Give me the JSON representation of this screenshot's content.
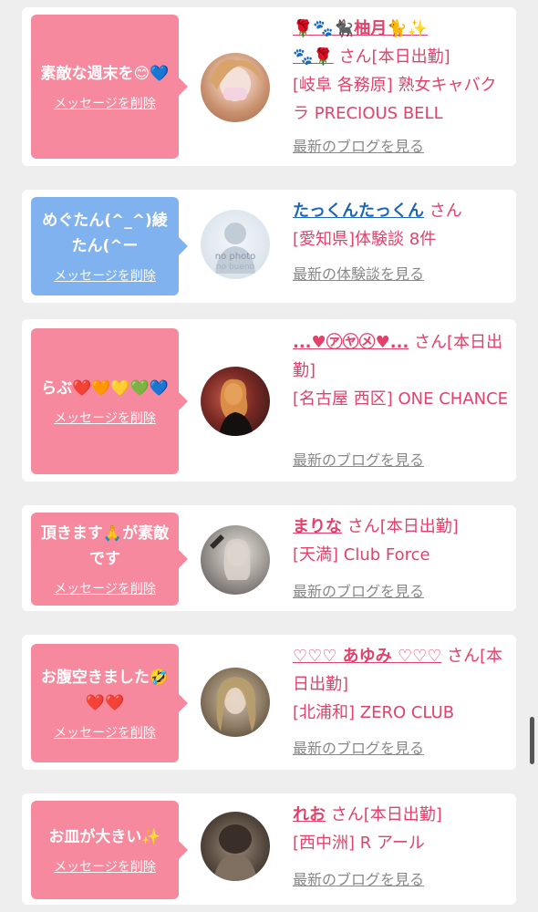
{
  "cards": [
    {
      "message": "素敵な週末を😊💙",
      "delete_label": "メッセージを削除",
      "name": "🌹🐾🐈‍⬛柚月🐈✨",
      "name_extra": "🐾🌹",
      "san": "さん[本日出勤]",
      "detail": "[岐阜 各務原] 熟女キャバクラ PRECIOUS BELL",
      "link": "最新のブログを見る"
    },
    {
      "message": "めぐたん(^_^)綾たん(^ー",
      "delete_label": "メッセージを削除",
      "name": "たっくんたっくん",
      "san": "さん",
      "detail": "[愛知県]体験談 8件",
      "link": "最新の体験談を見る",
      "avatar_text": "no photo",
      "avatar_text2": "no bueno"
    },
    {
      "message": "らぶ❤️🧡💛💚💙",
      "delete_label": "メッセージを削除",
      "name": "...♥㋐㋳㋱♥...",
      "san": "さん[本日出勤]",
      "detail": "[名古屋 西区] ONE CHANCE",
      "link": "最新のブログを見る"
    },
    {
      "message": "頂きます🙏が素敵です",
      "delete_label": "メッセージを削除",
      "name": "まりな",
      "san": "さん[本日出勤]",
      "detail": "[天満] Club Force",
      "link": "最新のブログを見る"
    },
    {
      "message": "お腹空きました🤣❤️❤️",
      "delete_label": "メッセージを削除",
      "name": "♡♡♡ あゆみ ♡♡♡",
      "san": "さん[本日出勤]",
      "detail": "[北浦和] ZERO CLUB",
      "link": "最新のブログを見る"
    },
    {
      "message": "お皿が大きい✨",
      "delete_label": "メッセージを削除",
      "name": "れお",
      "san": "さん[本日出勤]",
      "detail": "[西中洲] R アール",
      "link": "最新のブログを見る"
    }
  ],
  "colors": {
    "bubble_pink": "#f7899e",
    "bubble_blue": "#7fb2ee",
    "accent_text": "#e0426c",
    "link_gray": "#888888",
    "name_blue": "#1f66b8"
  }
}
